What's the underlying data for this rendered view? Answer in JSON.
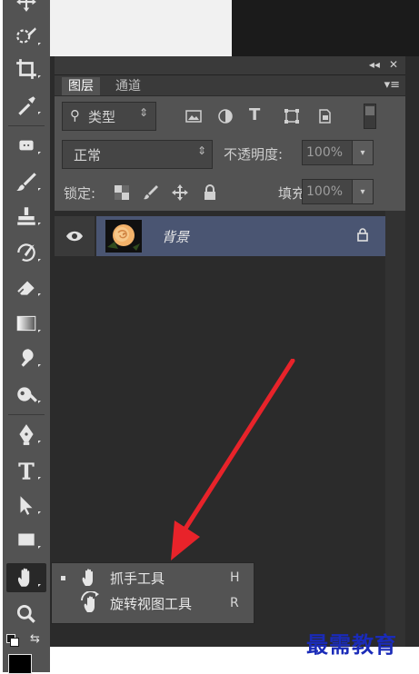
{
  "panel": {
    "tabs": [
      {
        "label": "图层",
        "active": true
      },
      {
        "label": "通道",
        "active": false
      }
    ],
    "controls": {
      "collapse": "◂◂",
      "close": "✕"
    },
    "menu_icon": "panel-menu-icon"
  },
  "filter": {
    "kind_label": "类型",
    "icons": [
      "pixel-filter-icon",
      "adjustment-filter-icon",
      "type-filter-icon",
      "shape-filter-icon",
      "smart-object-filter-icon"
    ]
  },
  "blend": {
    "mode": "正常",
    "opacity_label": "不透明度:",
    "opacity_value": "100%"
  },
  "lock": {
    "label": "锁定:",
    "fill_label": "填充:",
    "fill_value": "100%"
  },
  "layers": [
    {
      "name": "背景",
      "visible": true,
      "locked": true
    }
  ],
  "flyout": {
    "items": [
      {
        "label": "抓手工具",
        "shortcut": "H",
        "selected": true
      },
      {
        "label": "旋转视图工具",
        "shortcut": "R",
        "selected": false
      }
    ]
  },
  "watermark": "最需教育",
  "colors": {
    "toolbar_bg": "#535353",
    "panel_bg": "#2b2b2b",
    "layer_selected": "#4a5572",
    "arrow": "#e8232a",
    "watermark": "#1a2bb8"
  }
}
